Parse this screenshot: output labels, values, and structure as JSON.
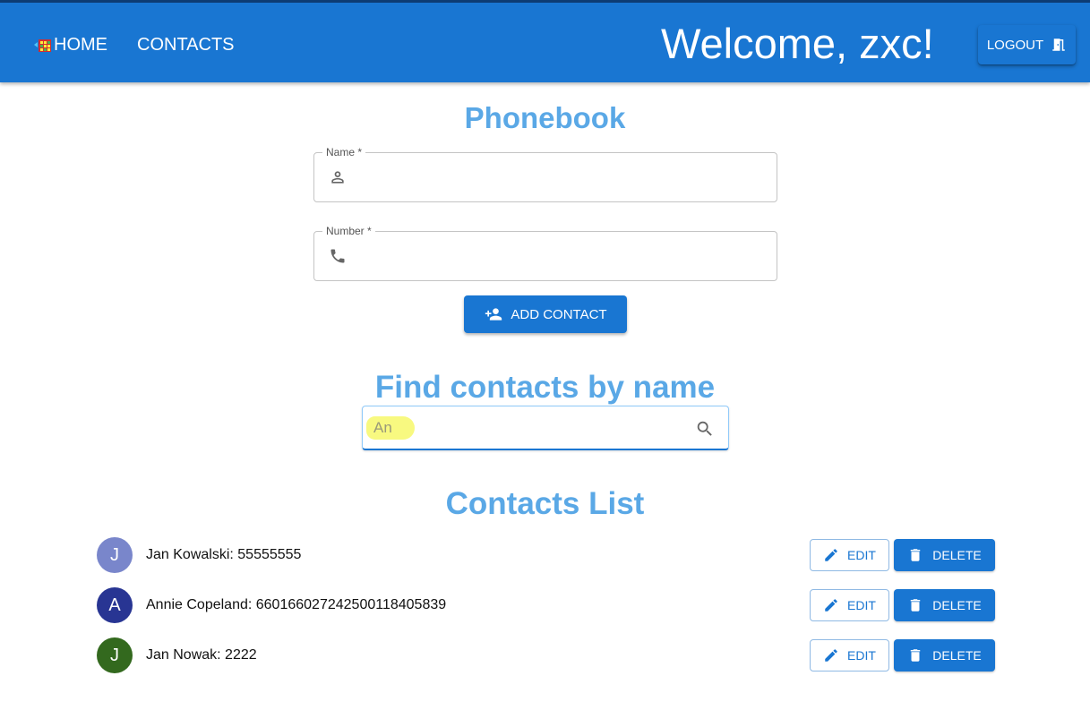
{
  "header": {
    "nav_home": "HOME",
    "nav_contacts": "CONTACTS",
    "welcome": "Welcome, zxc!",
    "logout_label": "LOGOUT",
    "bar_color": "#1976d2",
    "home_icon": "home-icon",
    "logout_icon": "door-exit-icon"
  },
  "phonebook": {
    "title": "Phonebook",
    "name_field": {
      "label": "Name *",
      "value": "",
      "icon": "person-icon"
    },
    "number_field": {
      "label": "Number *",
      "value": "",
      "icon": "phone-icon"
    },
    "add_label": "ADD CONTACT",
    "add_icon": "person-add-icon"
  },
  "search": {
    "title": "Find contacts by name",
    "placeholder": "An",
    "icon": "search-icon"
  },
  "contacts": {
    "title": "Contacts List",
    "edit_label": "EDIT",
    "delete_label": "DELETE",
    "items": [
      {
        "initial": "J",
        "text": "Jan Kowalski: 55555555",
        "avatar_color": "#7986cb"
      },
      {
        "initial": "A",
        "text": "Annie Copeland: 66016602724250011840583​9",
        "avatar_color": "#283593"
      },
      {
        "initial": "J",
        "text": "Jan Nowak: 2222",
        "avatar_color": "#33691e"
      }
    ]
  },
  "colors": {
    "accent": "#1976d2",
    "heading": "#5aa8e6"
  }
}
